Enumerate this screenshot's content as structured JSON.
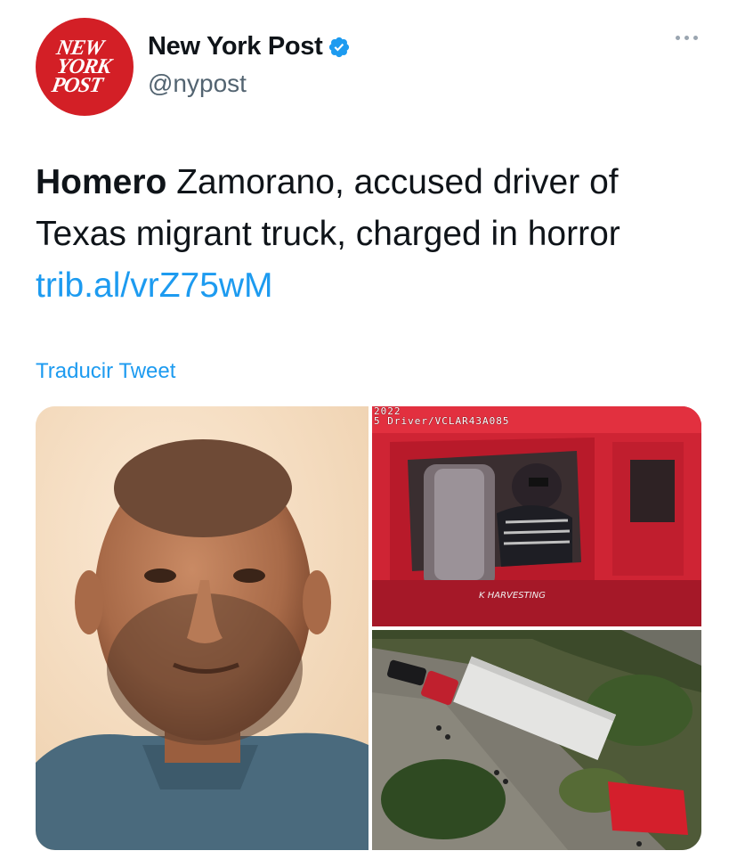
{
  "account": {
    "display_name": "New York Post",
    "handle": "@nypost",
    "logo_lines": [
      "NEW",
      "YORK",
      "POST"
    ],
    "verified": true
  },
  "tweet": {
    "text_bold": "Homero",
    "text_rest": " Zamorano, accused driver of Texas migrant truck, charged in horror",
    "link": "trib.al/vrZ75wM"
  },
  "translate_label": "Traducir Tweet",
  "media": {
    "cam_overlay_line1": "2022",
    "cam_overlay_line2": "5 Driver/VCLAR43A085"
  },
  "colors": {
    "brand_red": "#d31f26",
    "link_blue": "#1d9bf0",
    "verified_blue": "#1d9bf0",
    "secondary_text": "#536471"
  },
  "icons": {
    "verified": "verified-badge-icon",
    "more": "more-options-icon"
  }
}
